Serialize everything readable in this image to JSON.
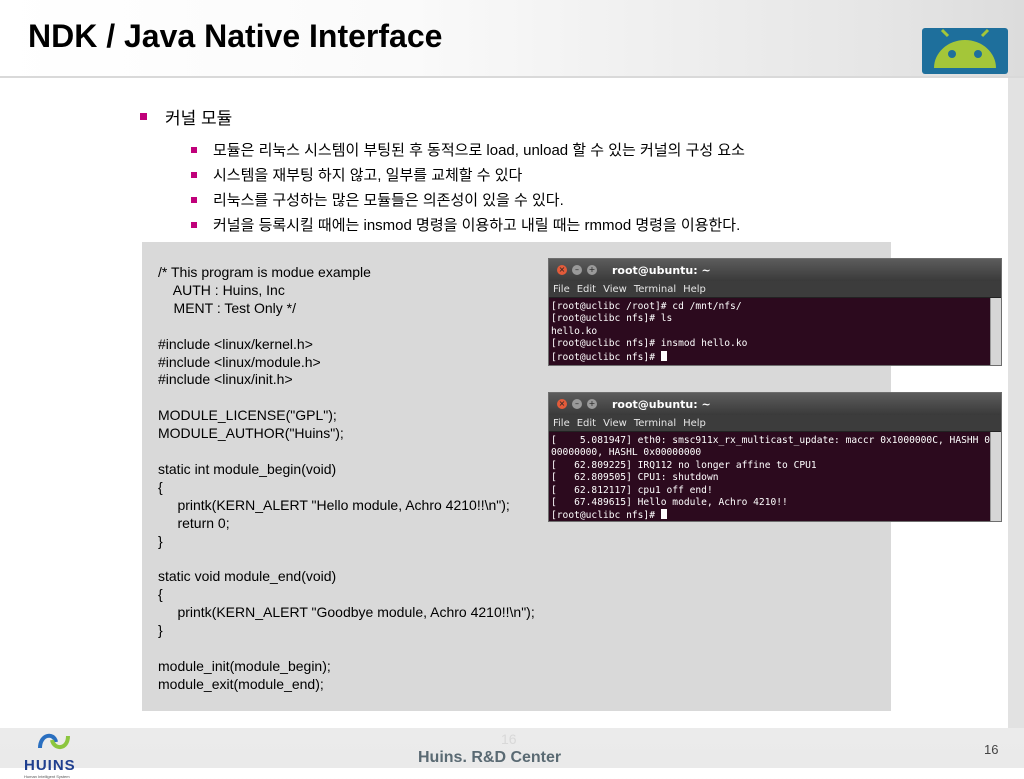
{
  "slide": {
    "title": "NDK / Java Native Interface",
    "heading": "커널 모듈",
    "bullets": [
      "모듈은 리눅스 시스템이 부팅된 후 동적으로 load, unload 할 수 있는 커널의 구성 요소",
      "시스템을 재부팅 하지 않고, 일부를 교체할 수 있다",
      "리눅스를 구성하는 많은 모듈들은 의존성이 있을 수 있다.",
      "커널을 등록시킬 때에는 insmod 명령을 이용하고 내릴 때는 rmmod 명령을 이용한다."
    ],
    "accent_color": "#c0007a"
  },
  "code": {
    "lines": [
      "/* This program is modue example",
      "    AUTH : Huins, Inc",
      "    MENT : Test Only */",
      "",
      "#include <linux/kernel.h>",
      "#include <linux/module.h>",
      "#include <linux/init.h>",
      "",
      "MODULE_LICENSE(\"GPL\");",
      "MODULE_AUTHOR(\"Huins\");",
      "",
      "static int module_begin(void)",
      "{",
      "     printk(KERN_ALERT \"Hello module, Achro 4210!!\\n\");",
      "     return 0;",
      "}",
      "",
      "static void module_end(void)",
      "{",
      "     printk(KERN_ALERT \"Goodbye module, Achro 4210!!\\n\");",
      "}",
      "",
      "module_init(module_begin);",
      "module_exit(module_end);"
    ]
  },
  "terminals": [
    {
      "title": "root@ubuntu: ~",
      "menu": [
        "File",
        "Edit",
        "View",
        "Terminal",
        "Help"
      ],
      "lines": [
        "[root@uclibc /root]# cd /mnt/nfs/",
        "[root@uclibc nfs]# ls",
        "hello.ko",
        "[root@uclibc nfs]# insmod hello.ko",
        "[root@uclibc nfs]# "
      ]
    },
    {
      "title": "root@ubuntu: ~",
      "menu": [
        "File",
        "Edit",
        "View",
        "Terminal",
        "Help"
      ],
      "lines": [
        "[    5.081947] eth0: smsc911x_rx_multicast_update: maccr 0x1000000C, HASHH 0x",
        "00000000, HASHL 0x00000000",
        "[   62.809225] IRQ112 no longer affine to CPU1",
        "[   62.809505] CPU1: shutdown",
        "[   62.812117] cpu1 off end!",
        "[   67.489615] Hello module, Achro 4210!!",
        "[root@uclibc nfs]# "
      ]
    }
  ],
  "footer": {
    "brand": "HUINS",
    "brand_sub": "Human Intelligent System",
    "center": "Huins. R&D Center",
    "faint_number": "16",
    "page_number": "16"
  }
}
